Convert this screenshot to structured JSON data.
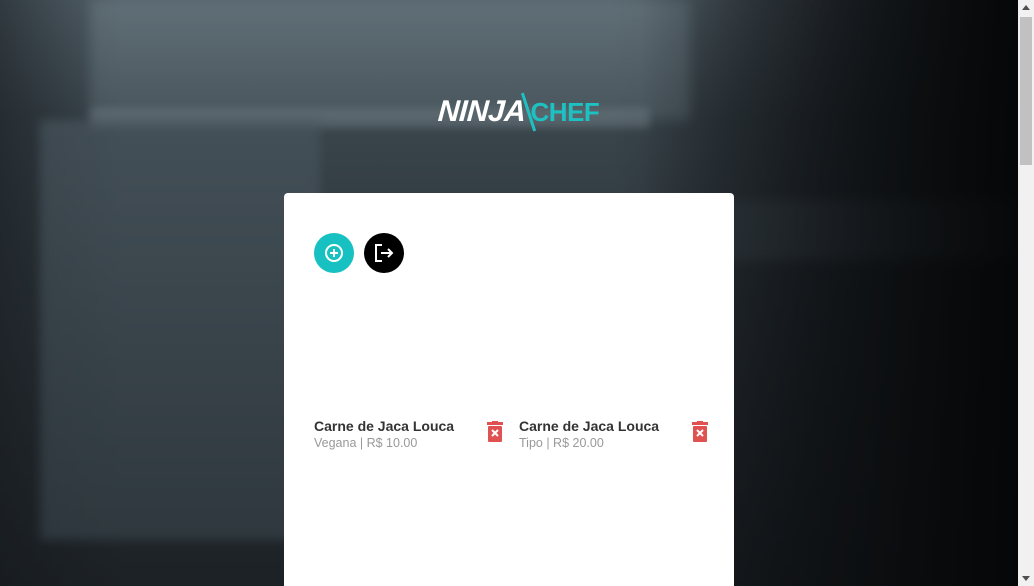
{
  "brand": {
    "logo_part1": "NINJA",
    "logo_part2": "CHEF",
    "accent_color": "#1ec1c1"
  },
  "toolbar": {
    "add_icon": "plus-circle-icon",
    "logout_icon": "logout-icon",
    "add_color": "#17c1c1",
    "logout_color": "#000000"
  },
  "items": [
    {
      "name": "Carne de Jaca Louca",
      "type": "Vegana",
      "price": "R$ 10.00",
      "meta": "Vegana | R$ 10.00",
      "delete_icon": "trash-icon"
    },
    {
      "name": "Carne de Jaca Louca",
      "type": "Tipo",
      "price": "R$ 20.00",
      "meta": "Tipo | R$ 20.00",
      "delete_icon": "trash-icon"
    }
  ],
  "delete_color": "#e05252"
}
